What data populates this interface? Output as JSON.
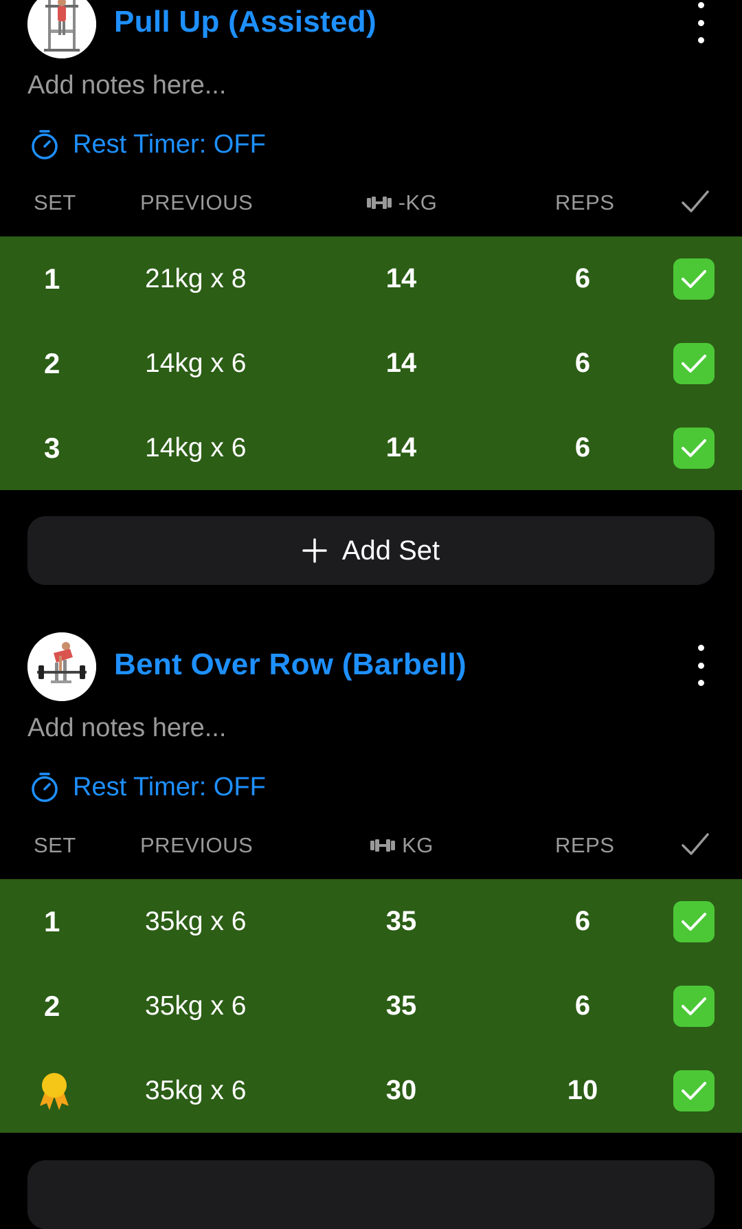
{
  "exercises": [
    {
      "title": "Pull Up (Assisted)",
      "notes_placeholder": "Add notes here...",
      "rest_timer": "Rest Timer: OFF",
      "columns": {
        "set": "SET",
        "previous": "PREVIOUS",
        "weight": "-KG",
        "reps": "REPS"
      },
      "sets": [
        {
          "set": "1",
          "previous": "21kg x 8",
          "kg": "14",
          "reps": "6"
        },
        {
          "set": "2",
          "previous": "14kg x 6",
          "kg": "14",
          "reps": "6"
        },
        {
          "set": "3",
          "previous": "14kg x 6",
          "kg": "14",
          "reps": "6"
        }
      ],
      "add_set_label": "Add Set"
    },
    {
      "title": "Bent Over Row (Barbell)",
      "notes_placeholder": "Add notes here...",
      "rest_timer": "Rest Timer: OFF",
      "columns": {
        "set": "SET",
        "previous": "PREVIOUS",
        "weight": "KG",
        "reps": "REPS"
      },
      "sets": [
        {
          "set": "1",
          "previous": "35kg x 6",
          "kg": "35",
          "reps": "6"
        },
        {
          "set": "2",
          "previous": "35kg x 6",
          "kg": "35",
          "reps": "6"
        },
        {
          "set": "",
          "badge": "medal-icon",
          "previous": "35kg x 6",
          "kg": "30",
          "reps": "10"
        }
      ]
    }
  ],
  "colors": {
    "accent": "#1e90ff",
    "completed_row": "#2c5e16",
    "check": "#4cc837",
    "medal": "#f5c518",
    "button_bg": "#1c1c1e"
  }
}
